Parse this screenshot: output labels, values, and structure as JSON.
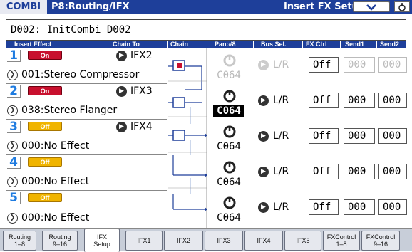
{
  "title": {
    "mode": "COMBI",
    "page": "P8:Routing/IFX",
    "setup": "Insert FX Setup",
    "menu_icon": "chevron-down-icon",
    "lock_icon": "lock-icon"
  },
  "combi_name": "D002: InitCombi D002",
  "headers": {
    "insert_effect": "Insert Effect",
    "chain_to": "Chain To",
    "chain": "Chain",
    "pan": "Pan:#8",
    "bus_sel": "Bus Sel.",
    "fx_ctrl": "FX Ctrl",
    "send1": "Send1",
    "send2": "Send2"
  },
  "effects": [
    {
      "num": "1",
      "state": "On",
      "chain_to": "IFX2",
      "name": "001:Stereo Compressor",
      "pan": "C064",
      "bus": "L/R",
      "fx_ctrl": "Off",
      "send1": "000",
      "send2": "000"
    },
    {
      "num": "2",
      "state": "On",
      "chain_to": "IFX3",
      "name": "038:Stereo Flanger",
      "pan": "C064",
      "bus": "L/R",
      "fx_ctrl": "Off",
      "send1": "000",
      "send2": "000"
    },
    {
      "num": "3",
      "state": "Off",
      "chain_to": "IFX4",
      "name": "000:No Effect",
      "pan": "C064",
      "bus": "L/R",
      "fx_ctrl": "Off",
      "send1": "000",
      "send2": "000"
    },
    {
      "num": "4",
      "state": "Off",
      "chain_to": "",
      "name": "000:No Effect",
      "pan": "C064",
      "bus": "L/R",
      "fx_ctrl": "Off",
      "send1": "000",
      "send2": "000"
    },
    {
      "num": "5",
      "state": "Off",
      "chain_to": "",
      "name": "000:No Effect",
      "pan": "C064",
      "bus": "L/R",
      "fx_ctrl": "Off",
      "send1": "000",
      "send2": "000"
    }
  ],
  "tabs": [
    {
      "label": "Routing\n1–8"
    },
    {
      "label": "Routing\n9–16"
    },
    {
      "label": "IFX\nSetup"
    },
    {
      "label": "IFX1"
    },
    {
      "label": "IFX2"
    },
    {
      "label": "IFX3"
    },
    {
      "label": "IFX4"
    },
    {
      "label": "IFX5"
    },
    {
      "label": "FXControl\n1–8"
    },
    {
      "label": "FXControl\n9–16"
    }
  ]
}
